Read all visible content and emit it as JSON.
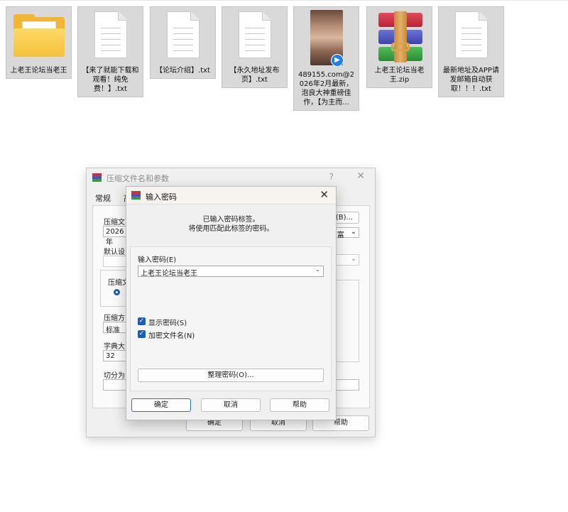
{
  "files": [
    {
      "name": "上老王论坛当老王",
      "icon": "folder-icon"
    },
    {
      "name": "【来了就能下载和观看！纯免费！】.txt",
      "icon": "text-file-icon"
    },
    {
      "name": "【论坛介绍】.txt",
      "icon": "text-file-icon"
    },
    {
      "name": "【永久地址发布页】.txt",
      "icon": "text-file-icon"
    },
    {
      "name": "489155.com@2026年2月最新，泡良大神重磅佳作，【为主而...",
      "icon": "video-file-icon"
    },
    {
      "name": "上老王论坛当老王.zip",
      "icon": "winrar-archive-icon"
    },
    {
      "name": "最新地址及APP请发邮箱自动获取！！！.txt",
      "icon": "text-file-icon"
    }
  ],
  "back_dialog": {
    "title": "压缩文件名和参数",
    "help_glyph": "?",
    "tabs": [
      "常规",
      "高"
    ],
    "archive_name_label": "压缩文",
    "archive_name_value": "2026年",
    "browse_button": "(B)...",
    "update_mode_value": "D富",
    "default_label": "默认设",
    "format_label": "压缩文",
    "method_label": "压缩方",
    "method_value": "标准",
    "dict_label": "字典大",
    "dict_value": "32",
    "split_label": "切分为",
    "ok": "确定",
    "cancel": "取消",
    "help": "帮助"
  },
  "password_dialog": {
    "title": "输入密码",
    "notice_line1": "已输入密码标签。",
    "notice_line2": "将使用匹配此标签的密码。",
    "input_label": "输入密码(E)",
    "password_value": "上老王论坛当老王",
    "show_password": "显示密码(S)",
    "show_password_checked": true,
    "encrypt_filenames": "加密文件名(N)",
    "encrypt_filenames_checked": true,
    "organize_button": "整理密码(O)...",
    "ok": "确定",
    "cancel": "取消",
    "help": "帮助"
  },
  "colors": {
    "accent": "#1a5fb4",
    "dialog_bg": "#f0f0f0",
    "tile_bg": "#d9d9d9"
  }
}
